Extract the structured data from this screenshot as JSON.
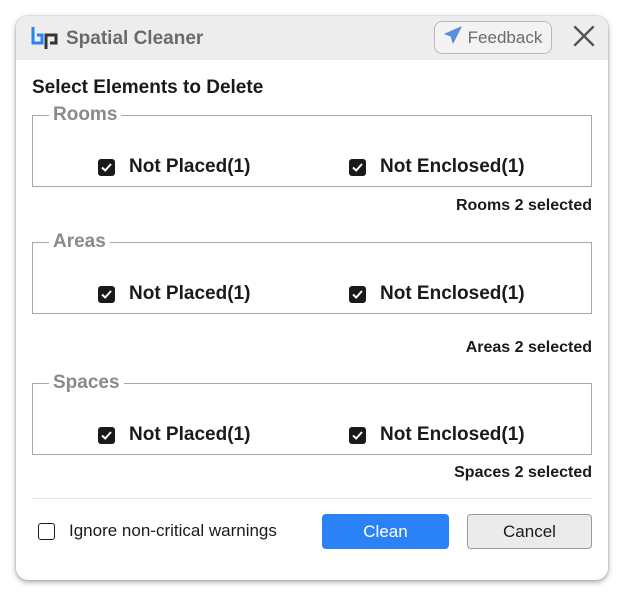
{
  "window": {
    "title": "Spatial Cleaner",
    "feedback_label": "Feedback",
    "logo_icon": "bp-logo-icon",
    "close_icon": "close-icon"
  },
  "heading": "Select Elements to Delete",
  "groups": [
    {
      "legend": "Rooms",
      "options": [
        {
          "label": "Not Placed(1)",
          "checked": true
        },
        {
          "label": "Not Enclosed(1)",
          "checked": true
        }
      ],
      "summary": "Rooms 2 selected"
    },
    {
      "legend": "Areas",
      "options": [
        {
          "label": "Not Placed(1)",
          "checked": true
        },
        {
          "label": "Not Enclosed(1)",
          "checked": true
        }
      ],
      "summary": "Areas 2 selected"
    },
    {
      "legend": "Spaces",
      "options": [
        {
          "label": "Not Placed(1)",
          "checked": true
        },
        {
          "label": "Not Enclosed(1)",
          "checked": true
        }
      ],
      "summary": "Spaces 2 selected"
    }
  ],
  "footer": {
    "ignore_label": "Ignore non-critical warnings",
    "ignore_checked": false,
    "clean_label": "Clean",
    "cancel_label": "Cancel"
  },
  "colors": {
    "accent": "#2b82f6",
    "logo_blue": "#2b82f6",
    "titlebar": "#ededed"
  }
}
